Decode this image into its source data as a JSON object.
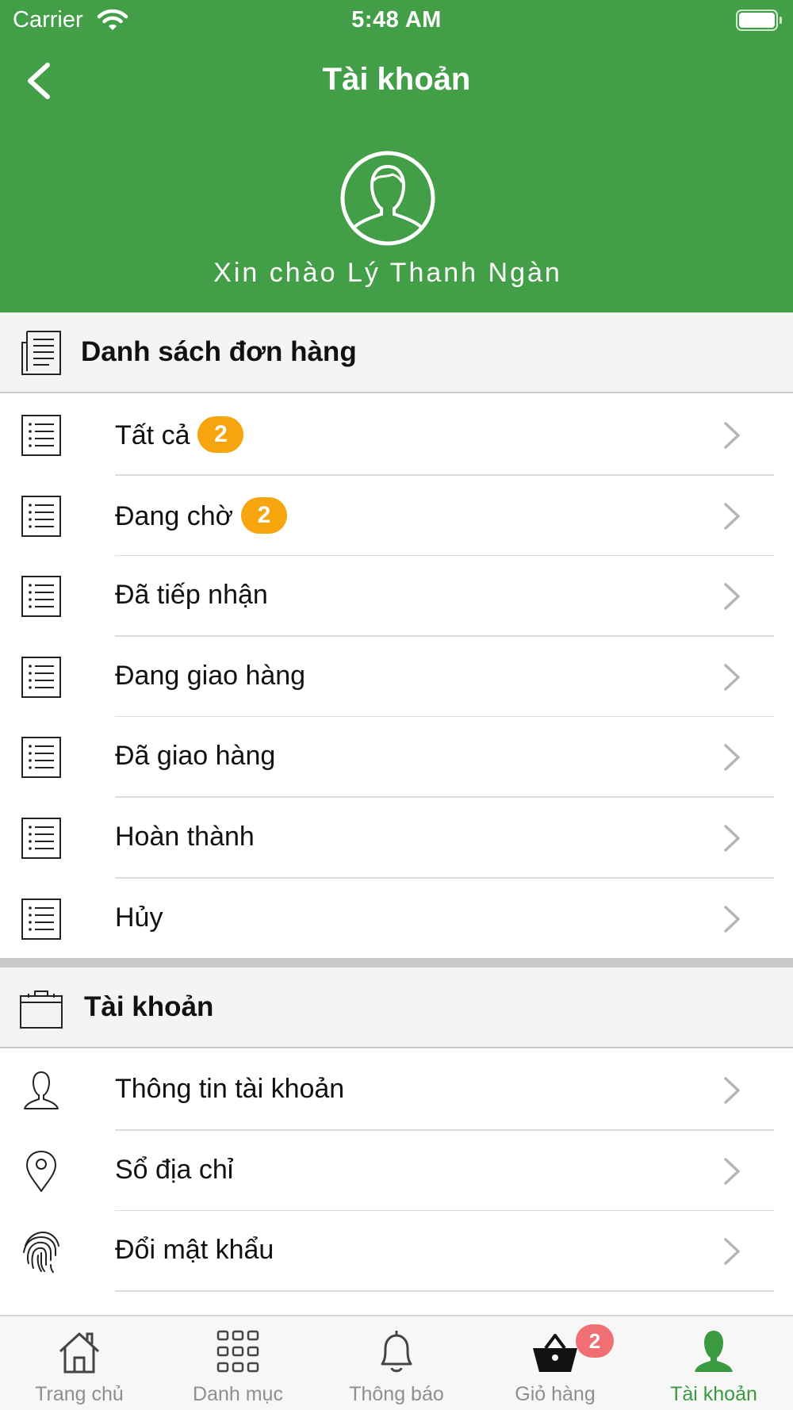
{
  "status_bar": {
    "carrier": "Carrier",
    "time": "5:48 AM"
  },
  "nav": {
    "title": "Tài khoản"
  },
  "profile": {
    "greeting": "Xin chào Lý Thanh Ngàn"
  },
  "orders_section": {
    "title": "Danh sách đơn hàng",
    "items": [
      {
        "label": "Tất cả",
        "badge": "2"
      },
      {
        "label": "Đang chờ",
        "badge": "2"
      },
      {
        "label": "Đã tiếp nhận"
      },
      {
        "label": "Đang giao hàng"
      },
      {
        "label": "Đã giao hàng"
      },
      {
        "label": "Hoàn thành"
      },
      {
        "label": "Hủy"
      }
    ]
  },
  "account_section": {
    "title": "Tài khoản",
    "items": [
      {
        "label": "Thông tin tài khoản",
        "icon": "person-outline-icon"
      },
      {
        "label": "Sổ địa chỉ",
        "icon": "location-pin-icon"
      },
      {
        "label": "Đổi mật khẩu",
        "icon": "fingerprint-icon"
      }
    ]
  },
  "tabbar": {
    "tabs": [
      {
        "label": "Trang chủ",
        "icon": "home-icon"
      },
      {
        "label": "Danh mục",
        "icon": "grid-icon"
      },
      {
        "label": "Thông báo",
        "icon": "bell-icon"
      },
      {
        "label": "Giỏ hàng",
        "icon": "basket-icon",
        "badge": "2"
      },
      {
        "label": "Tài khoản",
        "icon": "account-icon",
        "active": true
      }
    ]
  },
  "colors": {
    "header_green": "#439e48",
    "badge_orange": "#f6a50e",
    "active_tab": "#3a9a3f",
    "cart_badge": "#ef6f74"
  }
}
